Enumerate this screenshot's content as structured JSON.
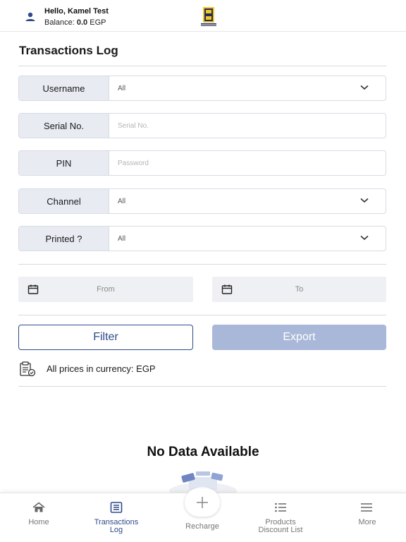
{
  "header": {
    "greeting": "Hello, Kamel Test",
    "balance_label": "Balance:",
    "balance_value": "0.0",
    "balance_currency": "EGP",
    "logo_icon": "brand-logo-icon"
  },
  "page": {
    "title": "Transactions Log"
  },
  "filters": {
    "username": {
      "label": "Username",
      "value": "All"
    },
    "serial": {
      "label": "Serial No.",
      "placeholder": "Serial No."
    },
    "pin": {
      "label": "PIN",
      "placeholder": "Password"
    },
    "channel": {
      "label": "Channel",
      "value": "All"
    },
    "printed": {
      "label": "Printed ?",
      "value": "All"
    }
  },
  "dates": {
    "from_placeholder": "From",
    "to_placeholder": "To"
  },
  "actions": {
    "filter_label": "Filter",
    "export_label": "Export"
  },
  "currency_note": "All prices in currency: EGP",
  "empty_state": "No Data Available",
  "bottom_nav": {
    "home": "Home",
    "transactions_line1": "Transactions",
    "transactions_line2": "Log",
    "recharge": "Recharge",
    "products_line1": "Products",
    "products_line2": "Discount List",
    "more": "More"
  },
  "colors": {
    "primary": "#2f4a8a",
    "export_disabled": "#a9b8d8",
    "label_bg": "#e8ebf2"
  }
}
